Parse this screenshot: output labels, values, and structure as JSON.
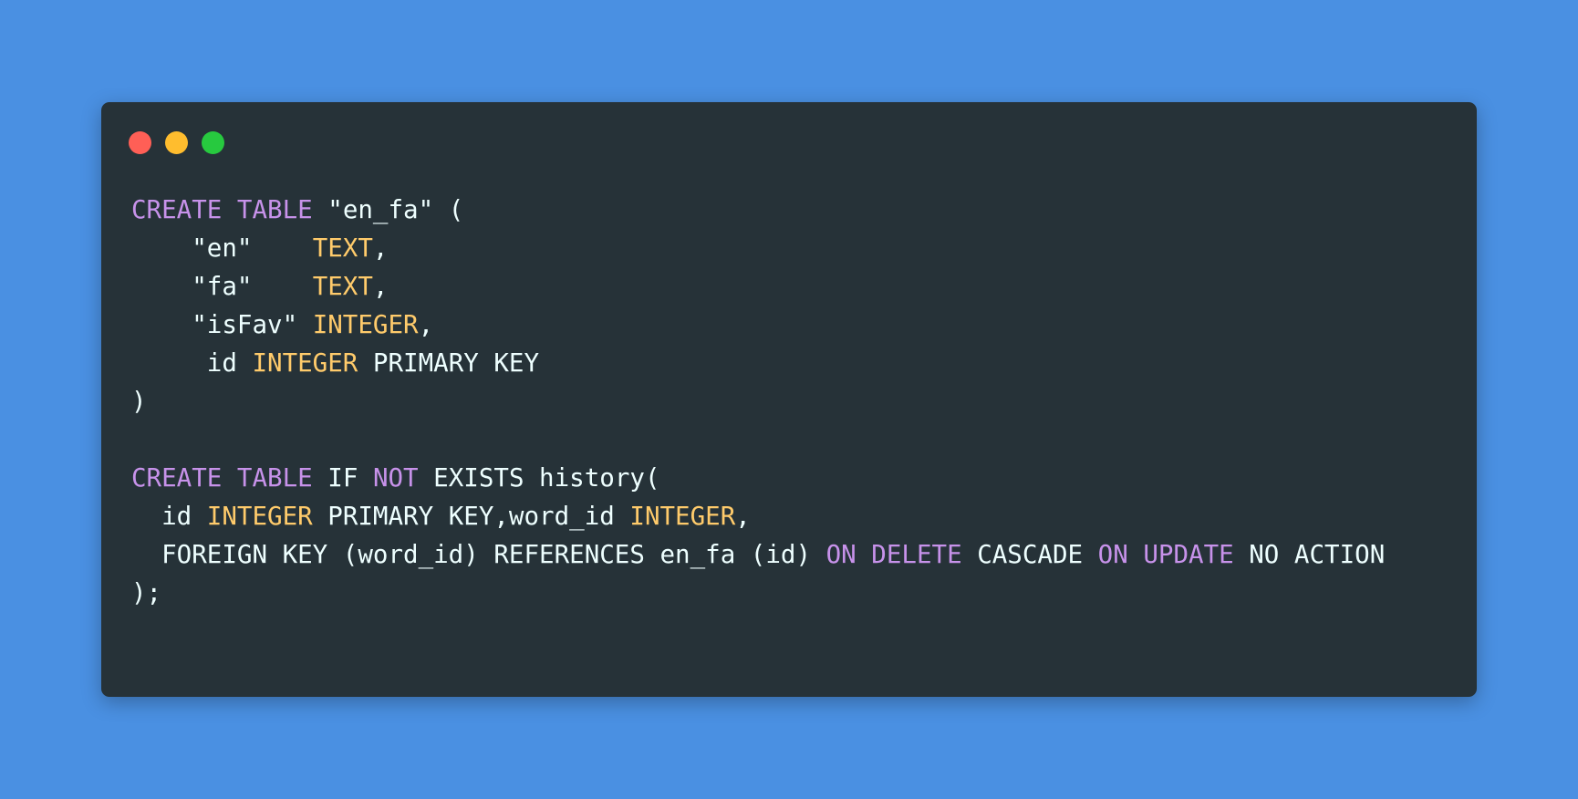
{
  "colors": {
    "background": "#4a90e2",
    "window": "#263238",
    "keyword": "#c792ea",
    "type": "#ffcb6b",
    "text": "#eeffff",
    "close": "#ff5f56",
    "minimize": "#ffbd2e",
    "maximize": "#27c93f"
  },
  "window_controls": [
    {
      "name": "close-dot",
      "icon": "red-circle-icon"
    },
    {
      "name": "minimize-dot",
      "icon": "yellow-circle-icon"
    },
    {
      "name": "maximize-dot",
      "icon": "green-circle-icon"
    }
  ],
  "code": {
    "language": "sql",
    "lines": [
      [
        {
          "t": "keyword",
          "v": "CREATE"
        },
        {
          "t": "plain",
          "v": " "
        },
        {
          "t": "keyword",
          "v": "TABLE"
        },
        {
          "t": "plain",
          "v": " \"en_fa\" ("
        }
      ],
      [
        {
          "t": "plain",
          "v": "    \"en\"    "
        },
        {
          "t": "type",
          "v": "TEXT"
        },
        {
          "t": "plain",
          "v": ","
        }
      ],
      [
        {
          "t": "plain",
          "v": "    \"fa\"    "
        },
        {
          "t": "type",
          "v": "TEXT"
        },
        {
          "t": "plain",
          "v": ","
        }
      ],
      [
        {
          "t": "plain",
          "v": "    \"isFav\" "
        },
        {
          "t": "type",
          "v": "INTEGER"
        },
        {
          "t": "plain",
          "v": ","
        }
      ],
      [
        {
          "t": "plain",
          "v": "     id "
        },
        {
          "t": "type",
          "v": "INTEGER"
        },
        {
          "t": "plain",
          "v": " PRIMARY KEY"
        }
      ],
      [
        {
          "t": "plain",
          "v": ")"
        }
      ],
      [],
      [
        {
          "t": "keyword",
          "v": "CREATE"
        },
        {
          "t": "plain",
          "v": " "
        },
        {
          "t": "keyword",
          "v": "TABLE"
        },
        {
          "t": "plain",
          "v": " IF "
        },
        {
          "t": "keyword",
          "v": "NOT"
        },
        {
          "t": "plain",
          "v": " EXISTS history("
        }
      ],
      [
        {
          "t": "plain",
          "v": "  id "
        },
        {
          "t": "type",
          "v": "INTEGER"
        },
        {
          "t": "plain",
          "v": " PRIMARY KEY,word_id "
        },
        {
          "t": "type",
          "v": "INTEGER"
        },
        {
          "t": "plain",
          "v": ","
        }
      ],
      [
        {
          "t": "plain",
          "v": "  FOREIGN KEY (word_id) REFERENCES en_fa (id) "
        },
        {
          "t": "keyword",
          "v": "ON"
        },
        {
          "t": "plain",
          "v": " "
        },
        {
          "t": "keyword",
          "v": "DELETE"
        },
        {
          "t": "plain",
          "v": " CASCADE "
        },
        {
          "t": "keyword",
          "v": "ON"
        },
        {
          "t": "plain",
          "v": " "
        },
        {
          "t": "keyword",
          "v": "UPDATE"
        },
        {
          "t": "plain",
          "v": " NO ACTION"
        }
      ],
      [
        {
          "t": "plain",
          "v": ");"
        }
      ]
    ]
  }
}
